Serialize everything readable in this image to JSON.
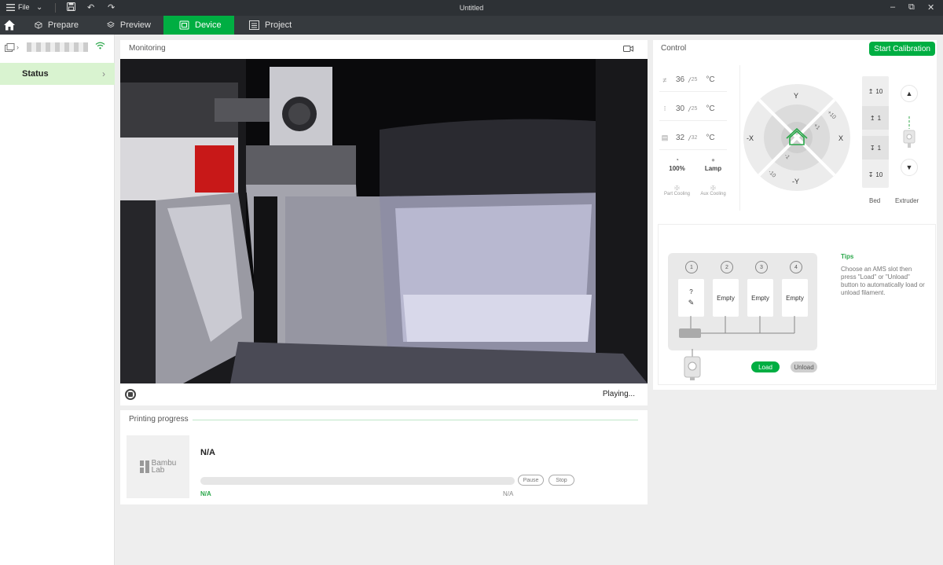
{
  "window": {
    "title": "Untitled",
    "file_menu_label": "File"
  },
  "tabs": [
    {
      "label": "Prepare",
      "icon": "cube-outline-icon"
    },
    {
      "label": "Preview",
      "icon": "layers-icon"
    },
    {
      "label": "Device",
      "icon": "device-icon",
      "active": true
    },
    {
      "label": "Project",
      "icon": "project-doc-icon"
    }
  ],
  "sidebar": {
    "status_label": "Status"
  },
  "monitoring": {
    "title": "Monitoring",
    "playback_status": "Playing..."
  },
  "progress": {
    "title": "Printing progress",
    "task_name": "N/A",
    "percent_text": "N/A",
    "time_text": "N/A",
    "pause_label": "Pause",
    "stop_label": "Stop",
    "progress_fraction": 0,
    "logo_text": [
      "Bambu",
      "Lab"
    ]
  },
  "control": {
    "title": "Control",
    "calibration_label": "Start Calibration",
    "temps": [
      {
        "name": "nozzle",
        "current": "36",
        "target": "25",
        "unit": "°C"
      },
      {
        "name": "bed",
        "current": "30",
        "target": "25",
        "unit": "°C"
      },
      {
        "name": "chamber",
        "current": "32",
        "target": "32",
        "unit": "°C"
      }
    ],
    "speed_label": "100%",
    "lamp_label": "Lamp",
    "part_cooling_label": "Part Cooling",
    "aux_cooling_label": "Aux Cooling",
    "axes": {
      "y_pos": "Y",
      "y_neg": "-Y",
      "x_pos": "X",
      "x_neg": "-X",
      "step_p10": "+10",
      "step_p1": "+1",
      "step_m1": "-1",
      "step_m10": "-10"
    },
    "bed_steps": [
      "10",
      "1",
      "1",
      "10"
    ],
    "bed_caption": "Bed",
    "extruder_caption": "Extruder"
  },
  "ams": {
    "slot_numbers": [
      "1",
      "2",
      "3",
      "4"
    ],
    "slots": [
      "?",
      "Empty",
      "Empty",
      "Empty"
    ],
    "tips_title": "Tips",
    "tips_text": "Choose an AMS slot then press \"Load\" or \"Unload\" button to automatically load or unload filament.",
    "load_label": "Load",
    "unload_label": "Unload"
  },
  "colors": {
    "accent": "#00ae42",
    "titlebar": "#2d3135",
    "tabbar": "#363a3e",
    "status_highlight": "#d9f3d0"
  }
}
